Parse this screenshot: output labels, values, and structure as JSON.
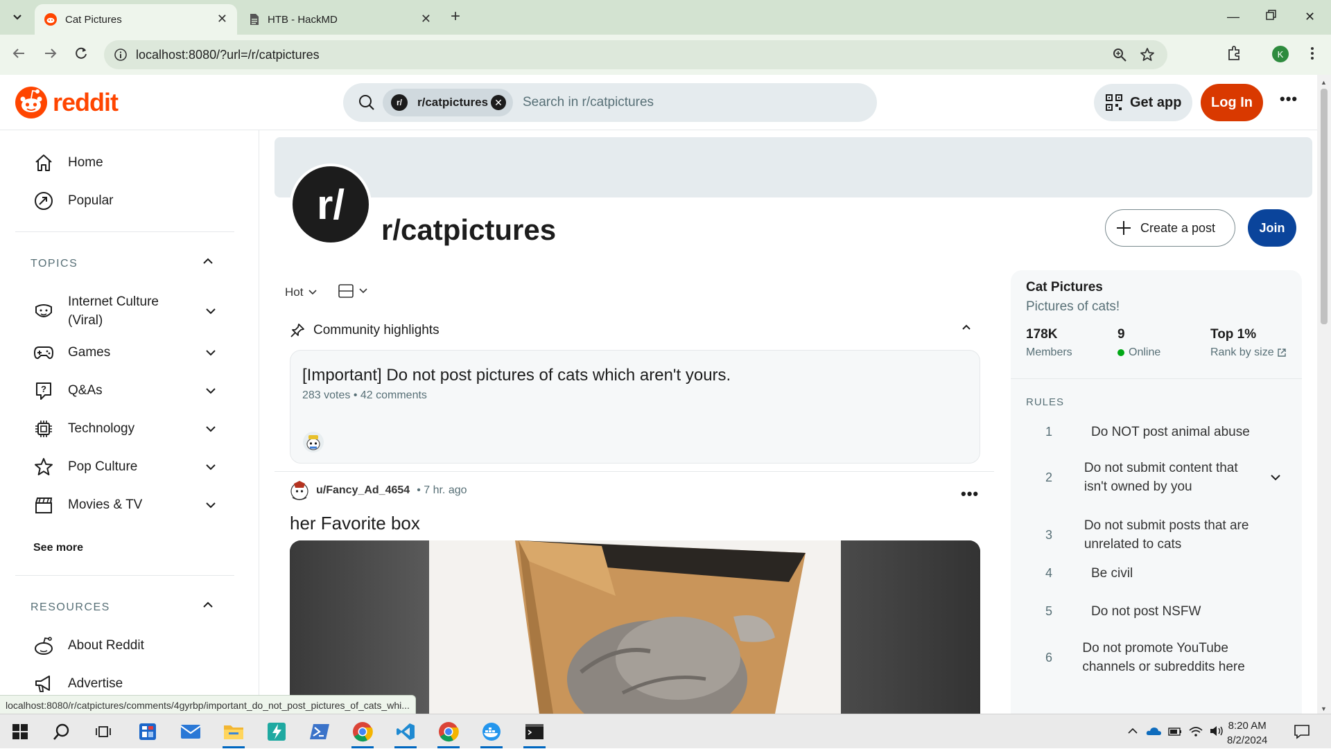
{
  "browser": {
    "tabs": [
      {
        "title": "Cat Pictures",
        "active": true
      },
      {
        "title": "HTB - HackMD",
        "active": false
      }
    ],
    "url": "localhost:8080/?url=/r/catpictures",
    "profile_initial": "K",
    "status_url": "localhost:8080/r/catpictures/comments/4gyrbp/important_do_not_post_pictures_of_cats_whi..."
  },
  "header": {
    "logo_text": "reddit",
    "search_chip": "r/catpictures",
    "search_chip_avatar": "r/",
    "search_placeholder": "Search in r/catpictures",
    "get_app": "Get app",
    "login": "Log In"
  },
  "sidebar": {
    "home": "Home",
    "popular": "Popular",
    "topics_header": "TOPICS",
    "topics": [
      {
        "label": "Internet Culture (Viral)",
        "icon": "internet-culture-icon"
      },
      {
        "label": "Games",
        "icon": "gamepad-icon"
      },
      {
        "label": "Q&As",
        "icon": "qa-icon"
      },
      {
        "label": "Technology",
        "icon": "chip-icon"
      },
      {
        "label": "Pop Culture",
        "icon": "star-icon"
      },
      {
        "label": "Movies & TV",
        "icon": "clapperboard-icon"
      }
    ],
    "see_more": "See more",
    "resources_header": "RESOURCES",
    "resources": [
      {
        "label": "About Reddit",
        "icon": "reddit-outline-icon"
      },
      {
        "label": "Advertise",
        "icon": "megaphone-icon"
      }
    ]
  },
  "subreddit": {
    "avatar_text": "r/",
    "name": "r/catpictures",
    "create_post": "Create a post",
    "join": "Join"
  },
  "feed": {
    "sort": "Hot",
    "highlights_title": "Community highlights",
    "highlight": {
      "title": "[Important] Do not post pictures of cats which aren't yours.",
      "meta": "283 votes • 42 comments"
    },
    "post": {
      "author": "u/Fancy_Ad_4654",
      "time": "• 7 hr. ago",
      "title": "her Favorite box"
    }
  },
  "community": {
    "title": "Cat Pictures",
    "description": "Pictures of cats!",
    "stats": [
      {
        "value": "178K",
        "label": "Members"
      },
      {
        "value": "9",
        "label": "Online"
      },
      {
        "value": "Top 1%",
        "label": "Rank by size"
      }
    ],
    "rules_header": "RULES",
    "rules": [
      {
        "n": "1",
        "text": "Do NOT post animal abuse"
      },
      {
        "n": "2",
        "text": "Do not submit content that isn't owned by you"
      },
      {
        "n": "3",
        "text": "Do not submit posts that are unrelated to cats"
      },
      {
        "n": "4",
        "text": "Be civil"
      },
      {
        "n": "5",
        "text": "Do not post NSFW"
      },
      {
        "n": "6",
        "text": "Do not promote YouTube channels or subreddits here"
      }
    ]
  },
  "taskbar": {
    "time": "8:20 AM",
    "date": "8/2/2024"
  },
  "colors": {
    "reddit_orange": "#ff4500",
    "login_button": "#d93900",
    "join_button": "#0a449b",
    "online_dot": "#01a816",
    "browser_frame": "#d3e3d1"
  }
}
